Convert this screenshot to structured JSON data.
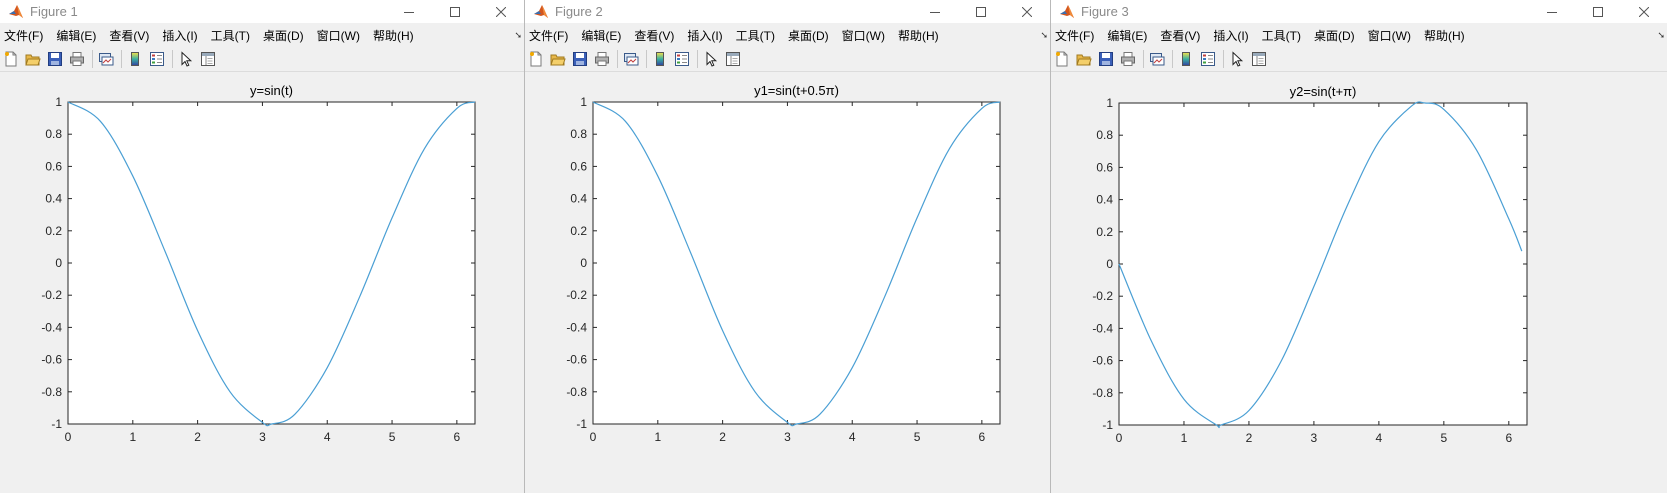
{
  "menu_items": [
    "文件(F)",
    "编辑(E)",
    "查看(V)",
    "插入(I)",
    "工具(T)",
    "桌面(D)",
    "窗口(W)",
    "帮助(H)"
  ],
  "colors": {
    "line": "#4a9fd4",
    "axes": "#262626",
    "titlebar": "#ffffff",
    "chrome": "#f0f0f0"
  },
  "icons": [
    "new-file-icon",
    "open-folder-icon",
    "save-icon",
    "print-icon",
    "link-plot-icon",
    "colorbar-icon",
    "legend-icon",
    "pointer-icon",
    "property-editor-icon"
  ],
  "windows": [
    {
      "title": "Figure 1"
    },
    {
      "title": "Figure 2"
    },
    {
      "title": "Figure 3"
    }
  ],
  "chart_data": [
    {
      "type": "line",
      "title": "y=sin(t)",
      "xlim": [
        0,
        6.28
      ],
      "ylim": [
        -1,
        1
      ],
      "x_ticks": [
        "0",
        "1",
        "2",
        "3",
        "4",
        "5",
        "6"
      ],
      "y_ticks": [
        "-1",
        "-0.8",
        "-0.6",
        "-0.4",
        "-0.2",
        "0",
        "0.2",
        "0.4",
        "0.6",
        "0.8",
        "1"
      ],
      "x": [
        0,
        0.5,
        1,
        1.5,
        2,
        2.5,
        3,
        3.14,
        3.5,
        4,
        4.5,
        5,
        5.5,
        6,
        6.28
      ],
      "y": [
        1,
        0.88,
        0.54,
        0.07,
        -0.42,
        -0.8,
        -0.99,
        -1,
        -0.94,
        -0.65,
        -0.21,
        0.28,
        0.71,
        0.96,
        1
      ],
      "grid": false
    },
    {
      "type": "line",
      "title": "y1=sin(t+0.5π)",
      "xlim": [
        0,
        6.28
      ],
      "ylim": [
        -1,
        1
      ],
      "x_ticks": [
        "0",
        "1",
        "2",
        "3",
        "4",
        "5",
        "6"
      ],
      "y_ticks": [
        "-1",
        "-0.8",
        "-0.6",
        "-0.4",
        "-0.2",
        "0",
        "0.2",
        "0.4",
        "0.6",
        "0.8",
        "1"
      ],
      "x": [
        0,
        0.5,
        1,
        1.5,
        2,
        2.5,
        3,
        3.14,
        3.5,
        4,
        4.5,
        5,
        5.5,
        6,
        6.28
      ],
      "y": [
        1,
        0.88,
        0.54,
        0.07,
        -0.42,
        -0.8,
        -0.99,
        -1,
        -0.94,
        -0.65,
        -0.21,
        0.28,
        0.71,
        0.96,
        1
      ],
      "grid": false
    },
    {
      "type": "line",
      "title": "y2=sin(t+π)",
      "xlim": [
        0,
        6.28
      ],
      "ylim": [
        -1,
        1
      ],
      "x_ticks": [
        "0",
        "1",
        "2",
        "3",
        "4",
        "5",
        "6"
      ],
      "y_ticks": [
        "-1",
        "-0.8",
        "-0.6",
        "-0.4",
        "-0.2",
        "0",
        "0.2",
        "0.4",
        "0.6",
        "0.8",
        "1"
      ],
      "x": [
        0,
        0.5,
        1,
        1.5,
        1.57,
        2,
        2.5,
        3,
        3.5,
        4,
        4.5,
        4.71,
        5,
        5.5,
        6,
        6.2
      ],
      "y": [
        0,
        -0.48,
        -0.84,
        -1,
        -1,
        -0.91,
        -0.6,
        -0.14,
        0.35,
        0.76,
        0.98,
        1,
        0.96,
        0.71,
        0.28,
        0.08
      ],
      "grid": false
    }
  ]
}
